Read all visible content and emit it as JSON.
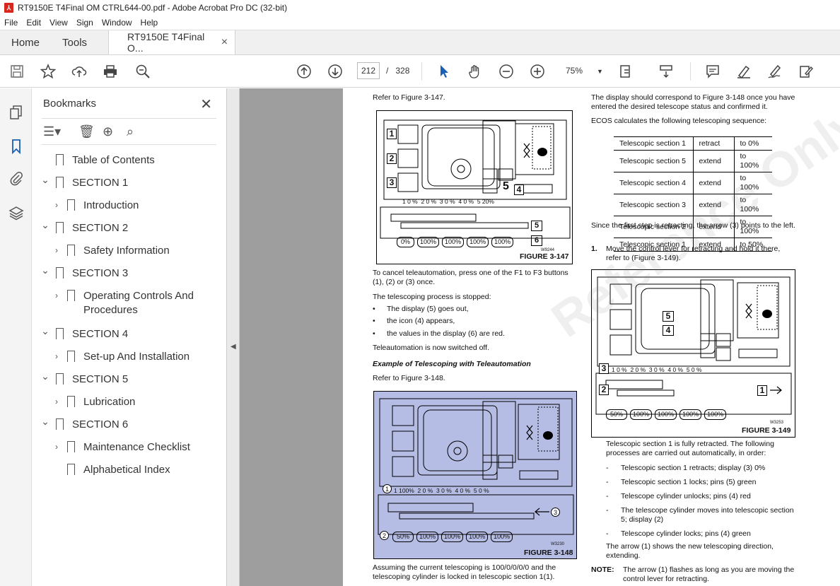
{
  "window": {
    "title": "RT9150E T4Final OM CTRL644-00.pdf - Adobe Acrobat Pro DC (32-bit)"
  },
  "menu": [
    "File",
    "Edit",
    "View",
    "Sign",
    "Window",
    "Help"
  ],
  "tabs": {
    "home": "Home",
    "tools": "Tools",
    "doc": "RT9150E T4Final O...",
    "close": "×"
  },
  "toolbar": {
    "page_current": "212",
    "page_sep": "/",
    "page_total": "328",
    "zoom": "75%"
  },
  "bookmarks": {
    "title": "Bookmarks",
    "close": "✕",
    "items": [
      {
        "label": "Table of Contents",
        "level": 0,
        "arrow": ""
      },
      {
        "label": "SECTION 1",
        "level": 0,
        "arrow": "⌄"
      },
      {
        "label": "Introduction",
        "level": 1,
        "arrow": "›"
      },
      {
        "label": "SECTION 2",
        "level": 0,
        "arrow": "⌄"
      },
      {
        "label": "Safety Information",
        "level": 1,
        "arrow": "›"
      },
      {
        "label": "SECTION 3",
        "level": 0,
        "arrow": "⌄"
      },
      {
        "label": "Operating Controls And Procedures",
        "level": 1,
        "arrow": "›"
      },
      {
        "label": "SECTION 4",
        "level": 0,
        "arrow": "⌄"
      },
      {
        "label": "Set-up And Installation",
        "level": 1,
        "arrow": "›"
      },
      {
        "label": "SECTION 5",
        "level": 0,
        "arrow": "⌄"
      },
      {
        "label": "Lubrication",
        "level": 1,
        "arrow": "›"
      },
      {
        "label": "SECTION 6",
        "level": 0,
        "arrow": "⌄"
      },
      {
        "label": "Maintenance Checklist",
        "level": 1,
        "arrow": "›"
      },
      {
        "label": "Alphabetical Index",
        "level": 1,
        "arrow": ""
      }
    ]
  },
  "doc": {
    "left": {
      "refer147": "Refer to Figure 3-147.",
      "fig147": "FIGURE 3-147",
      "cancel": "To cancel teleautomation, press one of the F1 to F3 buttons (1), (2) or (3) once.",
      "stopped": "The telescoping process is stopped:",
      "bullets": [
        "The display (5) goes out,",
        "the icon (4) appears,",
        "the values in the display (6) are red."
      ],
      "off": "Teleautomation is now switched off.",
      "example": "Example of Telescoping with Teleautomation",
      "refer148": "Refer to Figure 3-148.",
      "fig148": "FIGURE 3-148",
      "assuming": "Assuming the current telescoping is 100/0/0/0/0 and the telescoping cylinder is locked in telescopic section 1(1)."
    },
    "right": {
      "display": "The display should correspond to Figure 3-148 once you have entered the desired telescope status and confirmed it.",
      "ecos": "ECOS calculates the following telescoping sequence:",
      "table": [
        [
          "Telescopic section 1",
          "retract",
          "to 0%"
        ],
        [
          "Telescopic section 5",
          "extend",
          "to 100%"
        ],
        [
          "Telescopic section 4",
          "extend",
          "to 100%"
        ],
        [
          "Telescopic section 3",
          "extend",
          "to 100%"
        ],
        [
          "Telescopic section 2",
          "extend",
          "to 100%"
        ],
        [
          "Telescopic section 1",
          "extend",
          "to 50%"
        ]
      ],
      "since": "Since the first step is retracting, the arrow (3) points to the left.",
      "step1_num": "1.",
      "step1": "Move the control lever for retracting and hold it there, refer to (Figure 3-149).",
      "fig149": "FIGURE 3-149",
      "fully": "Telescopic section 1 is fully retracted. The following processes are carried out automatically, in order:",
      "dashes": [
        "Telescopic section 1 retracts; display (3) 0%",
        "Telescopic section 1 locks; pins (5) green",
        "Telescope cylinder unlocks; pins (4) red",
        "The telescope cylinder moves into telescopic section 5; display (2)",
        "Telescope cylinder locks; pins (4) green"
      ],
      "arrow": "The arrow (1) shows the new telescoping direction, extending.",
      "note_label": "NOTE:",
      "note": "The arrow (1) flashes as long as you are moving the control lever for retracting."
    },
    "fig147_labels": {
      "c1": "1",
      "c2": "2",
      "c3": "3",
      "c4": "4",
      "c5": "5",
      "c6": "6",
      "big5": "5",
      "code": "W9244",
      "sec_row": "1 0 %  2 0 %  3 0 %  4 0 %  5 20%",
      "pct_row": [
        "0%",
        "100%",
        "100%",
        "100%",
        "100%"
      ]
    },
    "fig148_labels": {
      "c1": "1",
      "c2": "2",
      "c3": "3",
      "code": "W3230",
      "sec_row": "1 100%  2 0 %  3 0 %  4 0 %  5 0 %",
      "pct_row": [
        "50%",
        "100%",
        "100%",
        "100%",
        "100%"
      ]
    },
    "fig149_labels": {
      "c1": "1",
      "c2": "2",
      "c3": "3",
      "c4": "4",
      "c5": "5",
      "code": "W3253",
      "sec_row": "1 0 %  2 0 %  3 0 %  4 0 %  5 0 %",
      "pct_row": [
        "50%",
        "100%",
        "100%",
        "100%",
        "100%"
      ]
    },
    "watermark": "Reference Only"
  }
}
